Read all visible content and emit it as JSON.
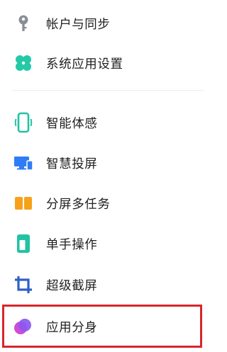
{
  "settings": {
    "items": [
      {
        "label": "帐户与同步",
        "icon": "key-icon"
      },
      {
        "label": "系统应用设置",
        "icon": "apps-grid-icon"
      },
      {
        "label": "智能体感",
        "icon": "phone-motion-icon"
      },
      {
        "label": "智慧投屏",
        "icon": "screen-cast-icon"
      },
      {
        "label": "分屏多任务",
        "icon": "split-screen-icon"
      },
      {
        "label": "单手操作",
        "icon": "one-hand-icon"
      },
      {
        "label": "超级截屏",
        "icon": "crop-icon"
      },
      {
        "label": "应用分身",
        "icon": "app-clone-icon"
      }
    ],
    "highlight_color": "#d8262b"
  }
}
